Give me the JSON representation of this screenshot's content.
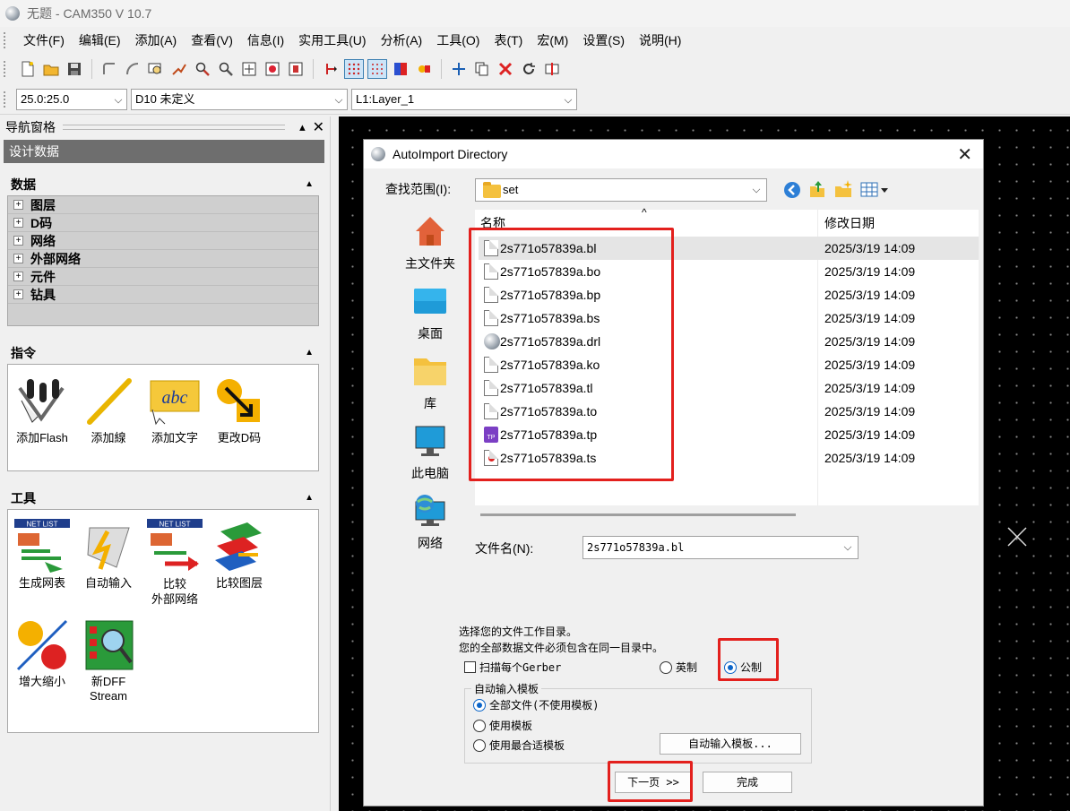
{
  "window": {
    "title": "无题 - CAM350 V 10.7"
  },
  "menu": [
    "文件(F)",
    "编辑(E)",
    "添加(A)",
    "查看(V)",
    "信息(I)",
    "实用工具(U)",
    "分析(A)",
    "工具(O)",
    "表(T)",
    "宏(M)",
    "设置(S)",
    "说明(H)"
  ],
  "combos": {
    "grid": "25.0:25.0",
    "dcode": "D10  未定义",
    "layer": "L1:Layer_1"
  },
  "nav": {
    "title": "导航窗格",
    "design_data": "设计数据",
    "data_section": {
      "title": "数据",
      "items": [
        "图层",
        "D码",
        "网络",
        "外部网络",
        "元件",
        "钻具"
      ]
    },
    "cmd_section": {
      "title": "指令",
      "items": [
        "添加Flash",
        "添加線",
        "添加文字",
        "更改D码"
      ]
    },
    "tools_section": {
      "title": "工具",
      "items": [
        "生成网表",
        "自动输入",
        "比较外部网络",
        "比较图层",
        "增大缩小",
        "新DFF Stream"
      ],
      "icon_text": {
        "netlist": "NET LIST",
        "abc": "abc"
      }
    }
  },
  "dialog": {
    "title": "AutoImport Directory",
    "lookin_label": "查找范围(I):",
    "lookin_value": "set",
    "places": [
      "主文件夹",
      "桌面",
      "库",
      "此电脑",
      "网络"
    ],
    "columns": {
      "name": "名称",
      "date": "修改日期"
    },
    "files": [
      {
        "name": "2s771o57839a.bl",
        "date": "2025/3/19 14:09",
        "icon": "document-icon"
      },
      {
        "name": "2s771o57839a.bo",
        "date": "2025/3/19 14:09",
        "icon": "document-icon"
      },
      {
        "name": "2s771o57839a.bp",
        "date": "2025/3/19 14:09",
        "icon": "document-icon"
      },
      {
        "name": "2s771o57839a.bs",
        "date": "2025/3/19 14:09",
        "icon": "document-icon"
      },
      {
        "name": "2s771o57839a.drl",
        "date": "2025/3/19 14:09",
        "icon": "cam-icon"
      },
      {
        "name": "2s771o57839a.ko",
        "date": "2025/3/19 14:09",
        "icon": "document-icon"
      },
      {
        "name": "2s771o57839a.tl",
        "date": "2025/3/19 14:09",
        "icon": "document-icon"
      },
      {
        "name": "2s771o57839a.to",
        "date": "2025/3/19 14:09",
        "icon": "document-icon"
      },
      {
        "name": "2s771o57839a.tp",
        "date": "2025/3/19 14:09",
        "icon": "tp-video-icon"
      },
      {
        "name": "2s771o57839a.ts",
        "date": "2025/3/19 14:09",
        "icon": "media-icon"
      }
    ],
    "filename_label": "文件名(N):",
    "filename_value": "2s771o57839a.bl",
    "instruction1": "选择您的文件工作目录。",
    "instruction2": "您的全部数据文件必须包含在同一目录中。",
    "scan_gerber": "扫描每个Gerber",
    "units": {
      "english": "英制",
      "metric": "公制",
      "selected": "metric"
    },
    "template_group": "自动输入模板",
    "template_options": [
      "全部文件(不使用模板)",
      "使用模板",
      "使用最合适模板"
    ],
    "template_button": "自动输入模板...",
    "next_button": "下一页  >>",
    "finish_button": "完成",
    "tp_badge": "TP"
  },
  "highlight_color": "#e3201d"
}
